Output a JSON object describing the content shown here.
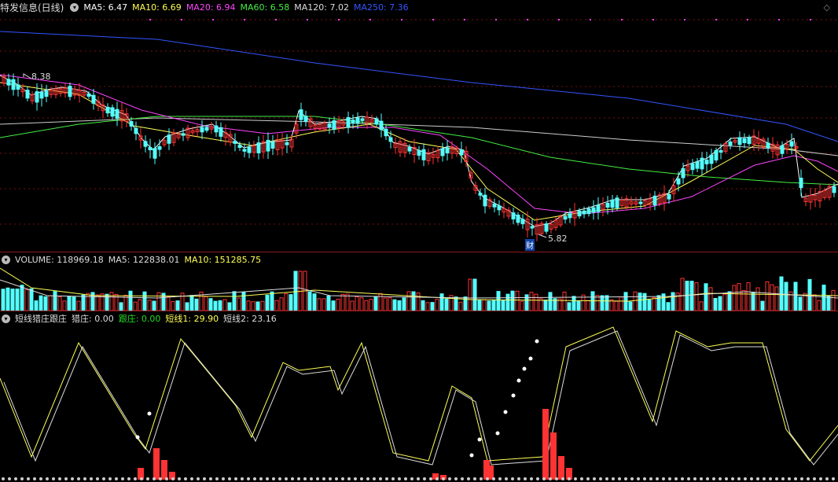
{
  "main": {
    "title": "特发信息(日线)",
    "ma": [
      {
        "label": "MA5: 6.47",
        "color": "#ffffff"
      },
      {
        "label": "MA10: 6.69",
        "color": "#ffff55"
      },
      {
        "label": "MA20: 6.94",
        "color": "#ff44ff"
      },
      {
        "label": "MA60: 6.58",
        "color": "#44ee44"
      },
      {
        "label": "MA120: 7.02",
        "color": "#dddddd"
      },
      {
        "label": "MA250: 7.36",
        "color": "#3355ff"
      }
    ],
    "high_label": "8.38",
    "low_label": "5.82",
    "badge": "财"
  },
  "volume": {
    "label": "VOLUME: 118969.18",
    "ma5": "MA5: 122838.01",
    "ma10": "MA10: 151285.75"
  },
  "indicator": {
    "name": "短线猎庄跟庄",
    "items": [
      {
        "label": "猎庄: 0.00",
        "color": "#dddddd"
      },
      {
        "label": "跟庄: 0.00",
        "color": "#22dd22"
      },
      {
        "label": "短线1: 29.90",
        "color": "#ffff55"
      },
      {
        "label": "短线2: 23.16",
        "color": "#dddddd"
      }
    ]
  },
  "colors": {
    "up": "#ff3333",
    "down": "#55ffff",
    "grid": "#7a1010",
    "ma250": "#3355ff"
  }
}
